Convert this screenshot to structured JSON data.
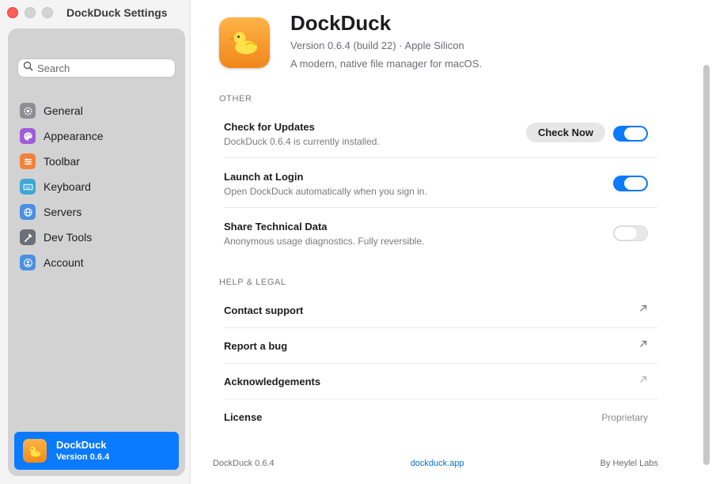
{
  "window": {
    "title": "DockDuck Settings"
  },
  "search": {
    "placeholder": "Search"
  },
  "sidebar": {
    "items": [
      {
        "label": "General",
        "icon": "gear-icon",
        "color": "#8e8e93"
      },
      {
        "label": "Appearance",
        "icon": "palette-icon",
        "color": "#a15cd8"
      },
      {
        "label": "Toolbar",
        "icon": "sliders-icon",
        "color": "#f0823a"
      },
      {
        "label": "Keyboard",
        "icon": "keyboard-icon",
        "color": "#3fa8d6"
      },
      {
        "label": "Servers",
        "icon": "globe-icon",
        "color": "#4a90e2"
      },
      {
        "label": "Dev Tools",
        "icon": "hammer-icon",
        "color": "#6b7079"
      },
      {
        "label": "Account",
        "icon": "person-icon",
        "color": "#4a90e2"
      }
    ],
    "app_card": {
      "name": "DockDuck",
      "version": "Version 0.6.4",
      "color": "#0a7aff"
    }
  },
  "header": {
    "title": "DockDuck",
    "version": "Version 0.6.4 (build 22) · Apple Silicon",
    "description": "A modern, native file manager for macOS."
  },
  "other": {
    "heading": "OTHER",
    "rows": [
      {
        "title": "Check for Updates",
        "subtitle": "DockDuck 0.6.4 is currently installed.",
        "button": "Check Now",
        "enabled": true
      },
      {
        "title": "Launch at Login",
        "subtitle": "Open DockDuck automatically when you sign in.",
        "enabled": true
      },
      {
        "title": "Share Technical Data",
        "subtitle": "Anonymous usage diagnostics. Fully reversible.",
        "enabled": false
      }
    ]
  },
  "help": {
    "heading": "HELP & LEGAL",
    "rows": [
      {
        "title": "Contact support"
      },
      {
        "title": "Report a bug"
      },
      {
        "title": "Acknowledgements"
      },
      {
        "title": "License",
        "value": "Proprietary"
      }
    ]
  },
  "footer": {
    "version": "DockDuck 0.6.4",
    "website": "dockduck.app",
    "credit": "By Heylel Labs"
  },
  "colors": {
    "accent": "#0a7aff",
    "close": "#ff5f57"
  }
}
